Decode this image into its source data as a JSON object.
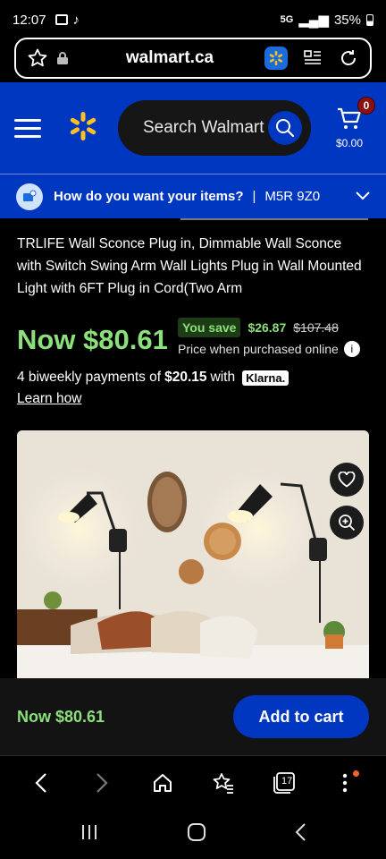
{
  "status": {
    "time": "12:07",
    "battery": "35%",
    "network": "5G"
  },
  "browser": {
    "url": "walmart.ca",
    "tab_count": "17"
  },
  "header": {
    "search_placeholder": "Search Walmart",
    "cart_count": "0",
    "cart_total": "$0.00"
  },
  "delivery": {
    "prompt": "How do you want your items?",
    "separator": "|",
    "postal_code": "M5R 9Z0"
  },
  "product": {
    "title": "TRLIFE Wall Sconce Plug in, Dimmable Wall Sconce with Switch Swing Arm Wall Lights Plug in Wall Mounted Light with 6FT Plug in Cord(Two Arm",
    "price_now": "Now $80.61",
    "you_save_label": "You save",
    "you_save_amount": "$26.87",
    "was_price": "$107.48",
    "price_note": "Price when purchased online",
    "klarna_prefix": "4 biweekly payments of",
    "klarna_amount": "$20.15",
    "klarna_with": "with",
    "klarna_brand": "Klarna.",
    "learn_how": "Learn how"
  },
  "sticky": {
    "price": "Now $80.61",
    "add_to_cart": "Add to cart"
  },
  "colors": {
    "walmart_blue": "#0037c1",
    "price_green": "#8be07b",
    "spark_yellow": "#ffc220"
  }
}
